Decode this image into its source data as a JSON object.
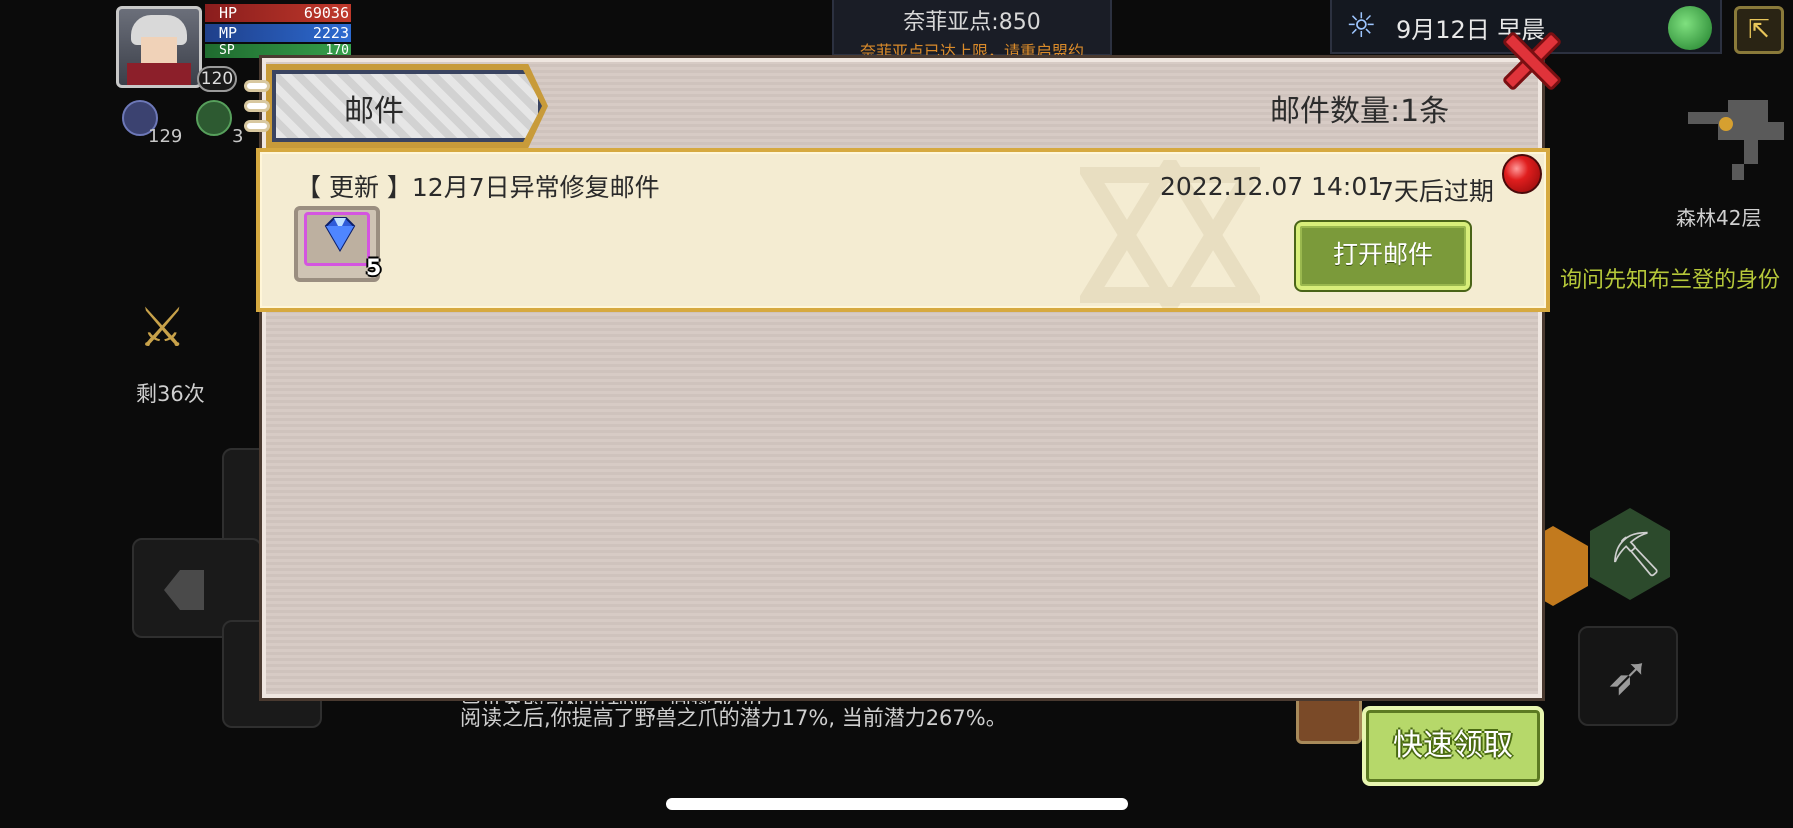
{
  "player": {
    "level": "120",
    "hp_label": "HP",
    "hp": "69036",
    "mp_label": "MP",
    "mp": "2223",
    "sp_label": "SP",
    "sp": "170",
    "resource_a": "129",
    "resource_b": "3"
  },
  "top_bar": {
    "nephia_points": "奈菲亚点:850",
    "nephia_warning": "奈菲亚点已达上限，请重启盟约",
    "date": "9月12日 早晨"
  },
  "side": {
    "floor": "森林42层",
    "quest": "询问先知布兰登的身份",
    "remaining": "剩36次"
  },
  "log": {
    "line1": "异世界的司机贝莉亚：阅读成功！",
    "line2": "阅读之后,你提高了野兽之爪的潜力17%, 当前潜力267%。"
  },
  "mail_window": {
    "tab_label": "邮件",
    "count_label": "邮件数量:1条",
    "items": [
      {
        "title": "【 更新 】12月7日异常修复邮件",
        "date": "2022.12.07 14:01",
        "expire": "7天后过期",
        "reward_qty": "5",
        "reward_icon": "blue-gem-icon",
        "open_label": "打开邮件"
      }
    ]
  },
  "actions": {
    "quick_claim": "快速领取"
  },
  "colors": {
    "accent_green": "#b6d86a",
    "close_red": "#e0333a",
    "gold_border": "#d6a940",
    "quest_text": "#b6c83a"
  }
}
